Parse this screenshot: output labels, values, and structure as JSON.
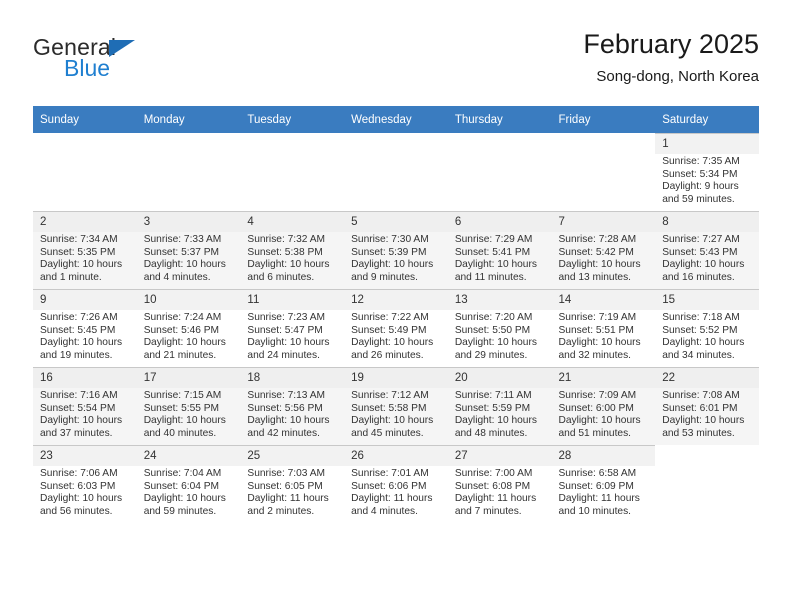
{
  "brand": {
    "name_part1": "General",
    "name_part2": "Blue",
    "triangle_color": "#1f6db5",
    "blue_color": "#1f7fd0"
  },
  "header": {
    "title": "February 2025",
    "subtitle": "Song-dong, North Korea"
  },
  "colors": {
    "header_row_bg": "#3a7cc0",
    "header_row_text": "#ffffff",
    "shaded_row_bg": "#f5f5f5",
    "daynum_bg": "#f2f2f2",
    "cell_border": "#c8c8c8",
    "body_text": "#333333"
  },
  "weekdays": [
    "Sunday",
    "Monday",
    "Tuesday",
    "Wednesday",
    "Thursday",
    "Friday",
    "Saturday"
  ],
  "weeks": [
    {
      "shaded": false,
      "days": [
        {
          "day": "",
          "empty": true
        },
        {
          "day": "",
          "empty": true
        },
        {
          "day": "",
          "empty": true
        },
        {
          "day": "",
          "empty": true
        },
        {
          "day": "",
          "empty": true
        },
        {
          "day": "",
          "empty": true
        },
        {
          "day": "1",
          "sunrise": "Sunrise: 7:35 AM",
          "sunset": "Sunset: 5:34 PM",
          "daylight1": "Daylight: 9 hours",
          "daylight2": "and 59 minutes."
        }
      ]
    },
    {
      "shaded": true,
      "days": [
        {
          "day": "2",
          "sunrise": "Sunrise: 7:34 AM",
          "sunset": "Sunset: 5:35 PM",
          "daylight1": "Daylight: 10 hours",
          "daylight2": "and 1 minute."
        },
        {
          "day": "3",
          "sunrise": "Sunrise: 7:33 AM",
          "sunset": "Sunset: 5:37 PM",
          "daylight1": "Daylight: 10 hours",
          "daylight2": "and 4 minutes."
        },
        {
          "day": "4",
          "sunrise": "Sunrise: 7:32 AM",
          "sunset": "Sunset: 5:38 PM",
          "daylight1": "Daylight: 10 hours",
          "daylight2": "and 6 minutes."
        },
        {
          "day": "5",
          "sunrise": "Sunrise: 7:30 AM",
          "sunset": "Sunset: 5:39 PM",
          "daylight1": "Daylight: 10 hours",
          "daylight2": "and 9 minutes."
        },
        {
          "day": "6",
          "sunrise": "Sunrise: 7:29 AM",
          "sunset": "Sunset: 5:41 PM",
          "daylight1": "Daylight: 10 hours",
          "daylight2": "and 11 minutes."
        },
        {
          "day": "7",
          "sunrise": "Sunrise: 7:28 AM",
          "sunset": "Sunset: 5:42 PM",
          "daylight1": "Daylight: 10 hours",
          "daylight2": "and 13 minutes."
        },
        {
          "day": "8",
          "sunrise": "Sunrise: 7:27 AM",
          "sunset": "Sunset: 5:43 PM",
          "daylight1": "Daylight: 10 hours",
          "daylight2": "and 16 minutes."
        }
      ]
    },
    {
      "shaded": false,
      "days": [
        {
          "day": "9",
          "sunrise": "Sunrise: 7:26 AM",
          "sunset": "Sunset: 5:45 PM",
          "daylight1": "Daylight: 10 hours",
          "daylight2": "and 19 minutes."
        },
        {
          "day": "10",
          "sunrise": "Sunrise: 7:24 AM",
          "sunset": "Sunset: 5:46 PM",
          "daylight1": "Daylight: 10 hours",
          "daylight2": "and 21 minutes."
        },
        {
          "day": "11",
          "sunrise": "Sunrise: 7:23 AM",
          "sunset": "Sunset: 5:47 PM",
          "daylight1": "Daylight: 10 hours",
          "daylight2": "and 24 minutes."
        },
        {
          "day": "12",
          "sunrise": "Sunrise: 7:22 AM",
          "sunset": "Sunset: 5:49 PM",
          "daylight1": "Daylight: 10 hours",
          "daylight2": "and 26 minutes."
        },
        {
          "day": "13",
          "sunrise": "Sunrise: 7:20 AM",
          "sunset": "Sunset: 5:50 PM",
          "daylight1": "Daylight: 10 hours",
          "daylight2": "and 29 minutes."
        },
        {
          "day": "14",
          "sunrise": "Sunrise: 7:19 AM",
          "sunset": "Sunset: 5:51 PM",
          "daylight1": "Daylight: 10 hours",
          "daylight2": "and 32 minutes."
        },
        {
          "day": "15",
          "sunrise": "Sunrise: 7:18 AM",
          "sunset": "Sunset: 5:52 PM",
          "daylight1": "Daylight: 10 hours",
          "daylight2": "and 34 minutes."
        }
      ]
    },
    {
      "shaded": true,
      "days": [
        {
          "day": "16",
          "sunrise": "Sunrise: 7:16 AM",
          "sunset": "Sunset: 5:54 PM",
          "daylight1": "Daylight: 10 hours",
          "daylight2": "and 37 minutes."
        },
        {
          "day": "17",
          "sunrise": "Sunrise: 7:15 AM",
          "sunset": "Sunset: 5:55 PM",
          "daylight1": "Daylight: 10 hours",
          "daylight2": "and 40 minutes."
        },
        {
          "day": "18",
          "sunrise": "Sunrise: 7:13 AM",
          "sunset": "Sunset: 5:56 PM",
          "daylight1": "Daylight: 10 hours",
          "daylight2": "and 42 minutes."
        },
        {
          "day": "19",
          "sunrise": "Sunrise: 7:12 AM",
          "sunset": "Sunset: 5:58 PM",
          "daylight1": "Daylight: 10 hours",
          "daylight2": "and 45 minutes."
        },
        {
          "day": "20",
          "sunrise": "Sunrise: 7:11 AM",
          "sunset": "Sunset: 5:59 PM",
          "daylight1": "Daylight: 10 hours",
          "daylight2": "and 48 minutes."
        },
        {
          "day": "21",
          "sunrise": "Sunrise: 7:09 AM",
          "sunset": "Sunset: 6:00 PM",
          "daylight1": "Daylight: 10 hours",
          "daylight2": "and 51 minutes."
        },
        {
          "day": "22",
          "sunrise": "Sunrise: 7:08 AM",
          "sunset": "Sunset: 6:01 PM",
          "daylight1": "Daylight: 10 hours",
          "daylight2": "and 53 minutes."
        }
      ]
    },
    {
      "shaded": false,
      "days": [
        {
          "day": "23",
          "sunrise": "Sunrise: 7:06 AM",
          "sunset": "Sunset: 6:03 PM",
          "daylight1": "Daylight: 10 hours",
          "daylight2": "and 56 minutes."
        },
        {
          "day": "24",
          "sunrise": "Sunrise: 7:04 AM",
          "sunset": "Sunset: 6:04 PM",
          "daylight1": "Daylight: 10 hours",
          "daylight2": "and 59 minutes."
        },
        {
          "day": "25",
          "sunrise": "Sunrise: 7:03 AM",
          "sunset": "Sunset: 6:05 PM",
          "daylight1": "Daylight: 11 hours",
          "daylight2": "and 2 minutes."
        },
        {
          "day": "26",
          "sunrise": "Sunrise: 7:01 AM",
          "sunset": "Sunset: 6:06 PM",
          "daylight1": "Daylight: 11 hours",
          "daylight2": "and 4 minutes."
        },
        {
          "day": "27",
          "sunrise": "Sunrise: 7:00 AM",
          "sunset": "Sunset: 6:08 PM",
          "daylight1": "Daylight: 11 hours",
          "daylight2": "and 7 minutes."
        },
        {
          "day": "28",
          "sunrise": "Sunrise: 6:58 AM",
          "sunset": "Sunset: 6:09 PM",
          "daylight1": "Daylight: 11 hours",
          "daylight2": "and 10 minutes."
        },
        {
          "day": "",
          "empty": true
        }
      ]
    }
  ]
}
